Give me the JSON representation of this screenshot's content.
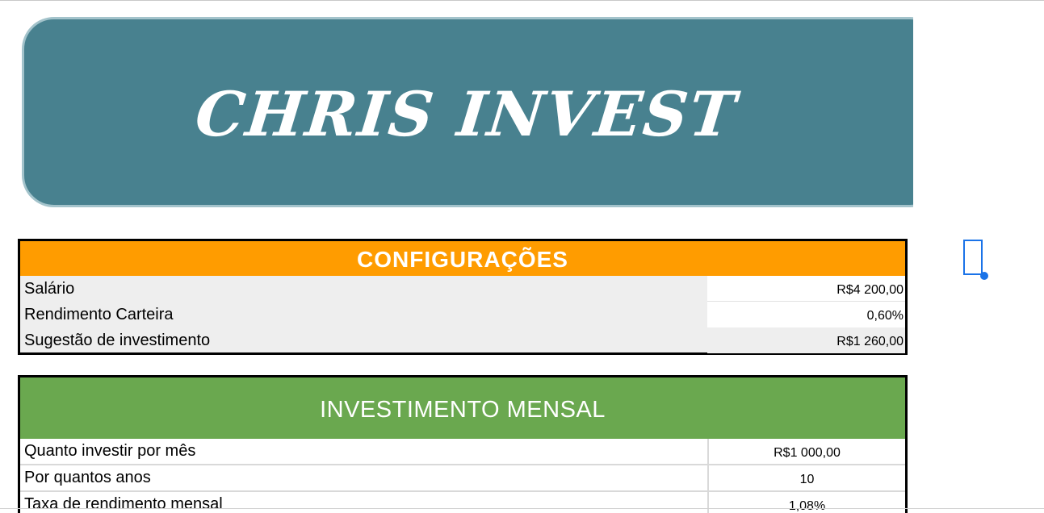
{
  "banner": {
    "title": "CHRIS INVEST"
  },
  "configuracoes": {
    "header": "CONFIGURAÇÕES",
    "rows": [
      {
        "label": "Salário",
        "value": "R$4 200,00"
      },
      {
        "label": "Rendimento Carteira",
        "value": "0,60%"
      },
      {
        "label": "Sugestão de investimento",
        "value": "R$1 260,00"
      }
    ]
  },
  "investimento_mensal": {
    "header": "INVESTIMENTO MENSAL",
    "rows": [
      {
        "label": "Quanto investir por mês",
        "value": "R$1 000,00"
      },
      {
        "label": "Por quantos anos",
        "value": "10"
      },
      {
        "label": "Taxa de rendimento mensal",
        "value": "1,08%"
      }
    ]
  },
  "colors": {
    "banner_bg": "#48818f",
    "config_header_bg": "#ff9c00",
    "investment_header_bg": "#6aa84f",
    "selection_accent": "#1a73e8"
  }
}
